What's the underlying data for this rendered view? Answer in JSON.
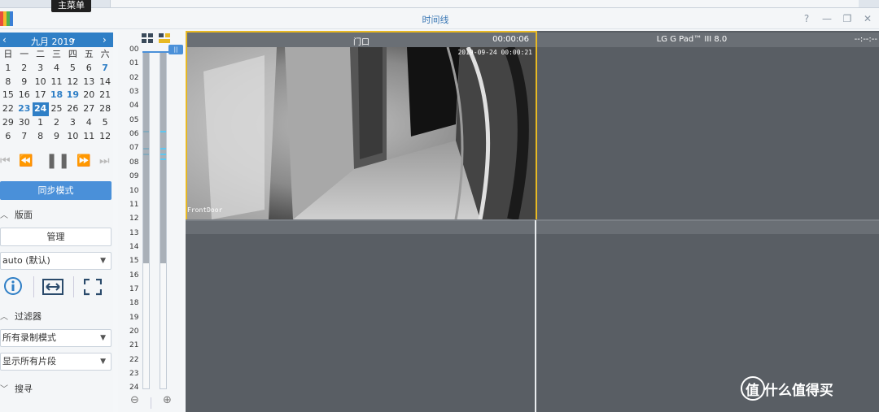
{
  "tooltip": "主菜单",
  "window": {
    "title": "时间线"
  },
  "calendar": {
    "month_label": "九月 2019",
    "weekdays": [
      "日",
      "一",
      "二",
      "三",
      "四",
      "五",
      "六"
    ],
    "weeks": [
      [
        "1",
        "2",
        "3",
        "4",
        "5",
        "6",
        "7"
      ],
      [
        "8",
        "9",
        "10",
        "11",
        "12",
        "13",
        "14"
      ],
      [
        "15",
        "16",
        "17",
        "18",
        "19",
        "20",
        "21"
      ],
      [
        "22",
        "23",
        "24",
        "25",
        "26",
        "27",
        "28"
      ],
      [
        "29",
        "30",
        "1",
        "2",
        "3",
        "4",
        "5"
      ],
      [
        "6",
        "7",
        "8",
        "9",
        "10",
        "11",
        "12"
      ]
    ]
  },
  "sidebar": {
    "sync_button": "同步模式",
    "layout_section": "版面",
    "manage_button": "管理",
    "layout_select": "auto (默认)",
    "filter_section": "过滤器",
    "record_mode_select": "所有录制模式",
    "segment_select": "显示所有片段",
    "search_section": "搜寻"
  },
  "timeline": {
    "hours": [
      "00",
      "01",
      "02",
      "03",
      "04",
      "05",
      "06",
      "07",
      "08",
      "09",
      "10",
      "11",
      "12",
      "13",
      "14",
      "15",
      "16",
      "17",
      "18",
      "19",
      "20",
      "21",
      "22",
      "23",
      "24"
    ]
  },
  "panes": [
    {
      "name": "门口",
      "time": "00:00:06",
      "osd_date": "2019-09-24 00:00:21",
      "osd_label": "FrontDoor"
    },
    {
      "name": "LG G Pad™ III 8.0",
      "time": "--:--:--"
    }
  ],
  "watermark": "值 什么值得买",
  "colors": {
    "accent": "#2f7fc6",
    "selected_border": "#e8b923",
    "pane_bg": "#595e64"
  }
}
